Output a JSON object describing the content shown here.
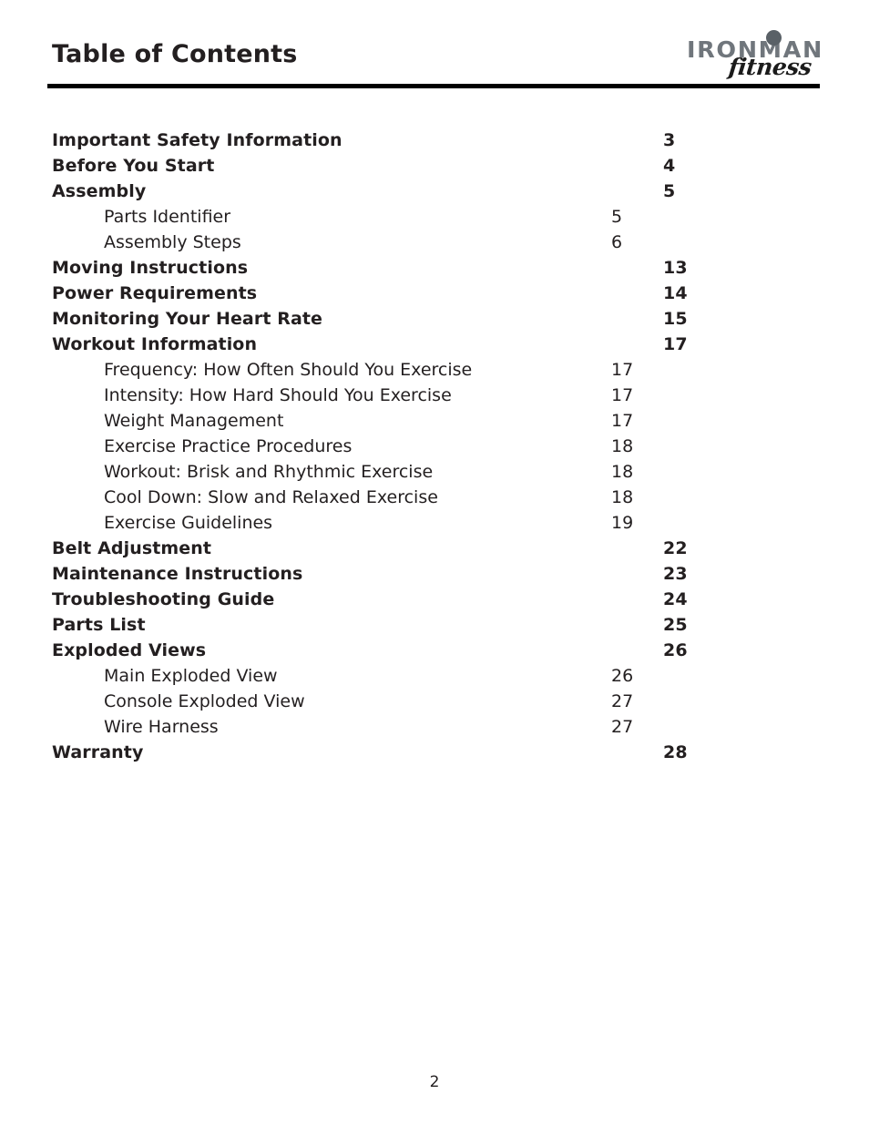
{
  "header": {
    "title": "Table of Contents"
  },
  "logo": {
    "wordmark": "IRONMAN",
    "script": "fitness",
    "wordmark_color": "#70767c",
    "dot_color": "#5a6167",
    "script_color": "#1b1b1b"
  },
  "toc": {
    "entries": [
      {
        "label": "Important Safety Information",
        "page": "3",
        "level": 0
      },
      {
        "label": "Before You Start",
        "page": "4",
        "level": 0
      },
      {
        "label": "Assembly",
        "page": "5",
        "level": 0
      },
      {
        "label": "Parts Identifier",
        "page": "5",
        "level": 1
      },
      {
        "label": "Assembly Steps",
        "page": "6",
        "level": 1
      },
      {
        "label": "Moving Instructions",
        "page": "13",
        "level": 0
      },
      {
        "label": "Power Requirements",
        "page": "14",
        "level": 0
      },
      {
        "label": "Monitoring Your Heart Rate",
        "page": "15",
        "level": 0
      },
      {
        "label": "Workout Information",
        "page": "17",
        "level": 0
      },
      {
        "label": "Frequency: How Often Should You Exercise",
        "page": "17",
        "level": 1
      },
      {
        "label": "Intensity: How Hard Should You Exercise",
        "page": "17",
        "level": 1
      },
      {
        "label": "Weight Management",
        "page": "17",
        "level": 1
      },
      {
        "label": "Exercise Practice Procedures",
        "page": "18",
        "level": 1
      },
      {
        "label": "Workout: Brisk and Rhythmic Exercise",
        "page": "18",
        "level": 1
      },
      {
        "label": "Cool Down: Slow and Relaxed Exercise",
        "page": "18",
        "level": 1
      },
      {
        "label": "Exercise Guidelines",
        "page": "19",
        "level": 1
      },
      {
        "label": "Belt Adjustment",
        "page": "22",
        "level": 0
      },
      {
        "label": "Maintenance Instructions",
        "page": "23",
        "level": 0
      },
      {
        "label": "Troubleshooting Guide",
        "page": "24",
        "level": 0
      },
      {
        "label": "Parts List",
        "page": "25",
        "level": 0
      },
      {
        "label": "Exploded Views",
        "page": "26",
        "level": 0
      },
      {
        "label": "Main Exploded View",
        "page": "26",
        "level": 1
      },
      {
        "label": "Console Exploded View",
        "page": "27",
        "level": 1
      },
      {
        "label": "Wire Harness",
        "page": "27",
        "level": 1
      },
      {
        "label": "Warranty",
        "page": "28",
        "level": 0
      }
    ]
  },
  "footer": {
    "page_number": "2"
  }
}
